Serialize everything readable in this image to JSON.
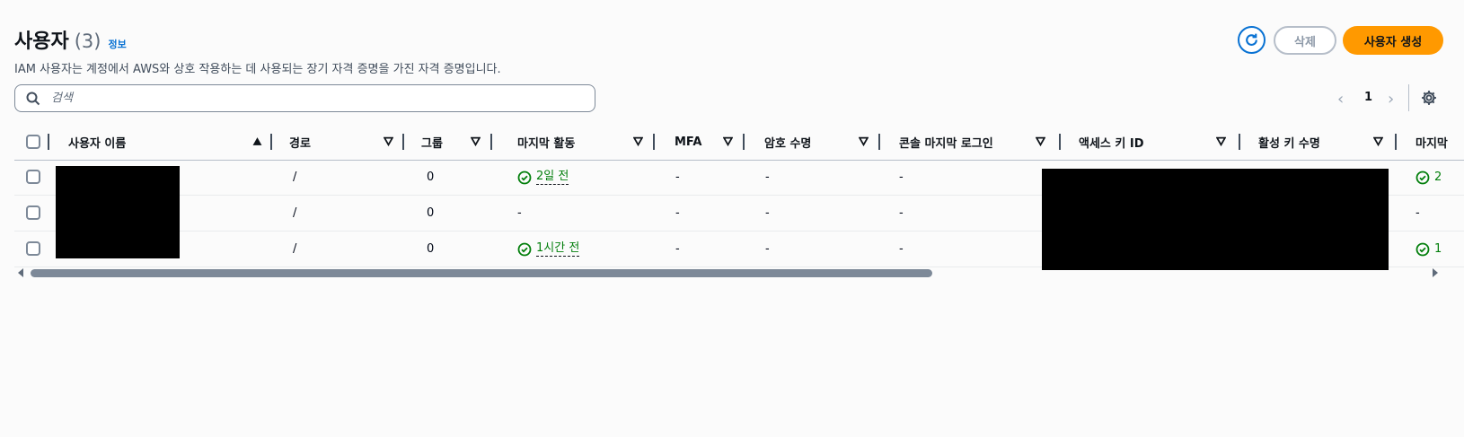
{
  "header": {
    "title": "사용자",
    "count": "(3)",
    "info_link": "정보",
    "description": "IAM 사용자는 계정에서 AWS와 상호 작용하는 데 사용되는 장기 자격 증명을 가진 자격 증명입니다."
  },
  "actions": {
    "refresh_icon": "refresh-icon",
    "delete_label": "삭제",
    "create_label": "사용자 생성"
  },
  "search": {
    "placeholder": "검색",
    "value": ""
  },
  "pagination": {
    "current_page": "1"
  },
  "table": {
    "columns": [
      "사용자 이름",
      "경로",
      "그룹",
      "마지막 활동",
      "MFA",
      "암호 수명",
      "콘솔 마지막 로그인",
      "액세스 키 ID",
      "활성 키 수명",
      "마지막"
    ],
    "rows": [
      {
        "path": "/",
        "groups": "0",
        "last_activity": "2일 전",
        "mfa": "-",
        "password_age": "-",
        "console_last_login": "-",
        "last_col": "2"
      },
      {
        "path": "/",
        "groups": "0",
        "last_activity": "-",
        "mfa": "-",
        "password_age": "-",
        "console_last_login": "-",
        "last_col": "-"
      },
      {
        "path": "/",
        "groups": "0",
        "last_activity": "1시간 전",
        "mfa": "-",
        "password_age": "-",
        "console_last_login": "-",
        "last_col": "1"
      }
    ]
  },
  "colors": {
    "accent": "#0972d3",
    "primary_button": "#ff9900",
    "success": "#037f0c",
    "background": "#fbfbfb"
  }
}
